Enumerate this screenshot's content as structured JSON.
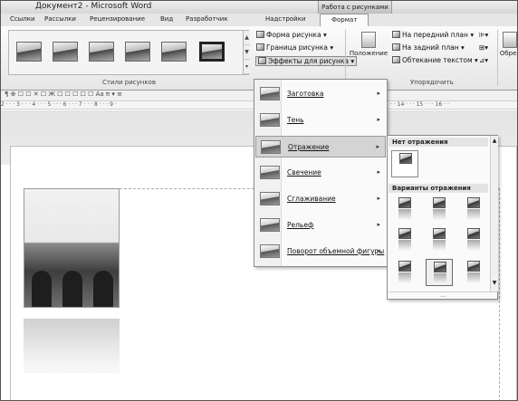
{
  "window": {
    "title": "Документ2 - Microsoft Word",
    "context_tab": "Работа с рисунками"
  },
  "tabs": [
    "Ссылки",
    "Рассылки",
    "Рецензирование",
    "Вид",
    "Разработчик",
    "Надстройки",
    "Формат"
  ],
  "active_tab": "Формат",
  "ribbon": {
    "styles_group_label": "Стили рисунков",
    "picture_shape": "Форма рисунка ▾",
    "picture_border": "Граница рисунка ▾",
    "picture_effects": "Эффекты для рисунка ▾",
    "position": "Положение",
    "bring_front": "На передний план ▾",
    "send_back": "На задний план ▾",
    "text_wrap": "Обтекание текстом ▾",
    "arrange_label": "Упорядочить",
    "crop": "Обрез"
  },
  "quick_toolbar": "¶ ⊕ ☐ ☐ ✕ ☐ Ж ☐ ☐ ☐ ☐ ☐ Аа π ▾ ≡",
  "ruler": {
    "left": "2 · · · 3 · · · 4 · · · 5 · · · 6 · · · 7 · · · 8 · · · 9 ·",
    "right": "· · 14 · · · 15 · · · 16 · ·"
  },
  "effects_menu": {
    "items": [
      {
        "label": "Заготовка",
        "arrow": "▸"
      },
      {
        "label": "Тень",
        "arrow": "▸"
      },
      {
        "label": "Отражение",
        "arrow": "▸"
      },
      {
        "label": "Свечение",
        "arrow": "▸"
      },
      {
        "label": "Сглаживание",
        "arrow": "▸"
      },
      {
        "label": "Рельеф",
        "arrow": "▸"
      },
      {
        "label": "Поворот объемной фигуры",
        "arrow": "▸"
      }
    ],
    "highlighted_index": 2
  },
  "reflection_submenu": {
    "no_reflection_header": "Нет отражения",
    "variants_header": "Варианты отражения",
    "scroll_up": "▲",
    "scroll_down": "▼",
    "footer": "....",
    "selected_variant": 7
  }
}
